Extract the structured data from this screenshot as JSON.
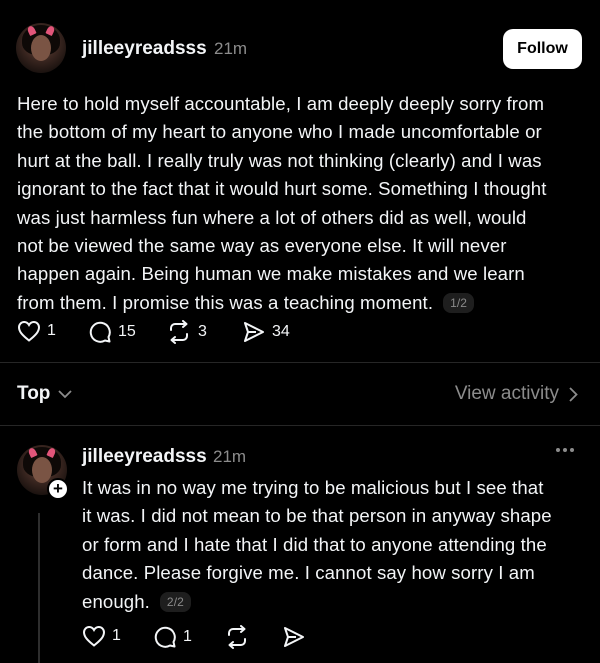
{
  "main_post": {
    "username": "jilleeyreadsss",
    "time": "21m",
    "follow_label": "Follow",
    "lines": [
      "Here to hold myself accountable, I am deeply deeply sorry from",
      "the bottom of my heart to anyone who I made uncomfortable or",
      "hurt at the ball. I really truly was not thinking (clearly) and I was",
      "ignorant to the fact that it would hurt some. Something I thought",
      "was just harmless fun where a lot of others did as well, would",
      "not be viewed the same way as everyone else. It will never",
      "happen again. Being human we make mistakes and we learn",
      "from them. I promise this was a teaching moment."
    ],
    "pager": "1/2",
    "likes": "1",
    "replies": "15",
    "reposts": "3",
    "shares": "34"
  },
  "sort": {
    "label": "Top",
    "view_activity": "View activity"
  },
  "reply_post": {
    "username": "jilleeyreadsss",
    "time": "21m",
    "lines": [
      "It was in no way me trying to be malicious but I see that",
      "it was. I did not mean to be that person in anyway shape",
      "or form and I hate that I did that to anyone attending the",
      "dance. Please forgive me. I cannot say how sorry I am",
      "enough."
    ],
    "pager": "2/2",
    "likes": "1",
    "replies": "1"
  },
  "colors": {
    "background": "#000000",
    "text": "#f3f5f7",
    "muted": "#8c8c8c",
    "follow_bg": "#ffffff"
  },
  "icons": [
    "heart-icon",
    "comment-icon",
    "repost-icon",
    "share-icon",
    "chevron-down-icon",
    "chevron-right-icon",
    "plus-icon",
    "more-icon"
  ]
}
